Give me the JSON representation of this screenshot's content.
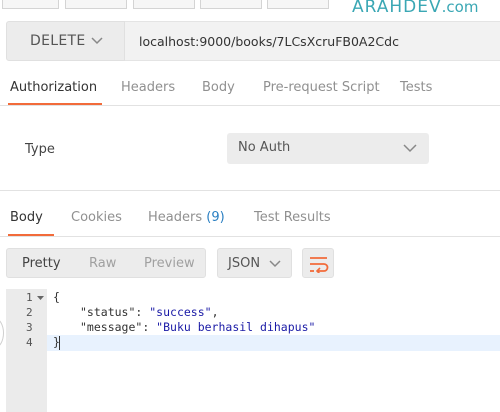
{
  "watermark": {
    "brand": "ARAHDEV",
    "tld": ".com"
  },
  "request": {
    "method": "DELETE",
    "url": "localhost:9000/books/7LCsXcruFB0A2Cdc"
  },
  "request_tabs": [
    {
      "label": "Authorization",
      "active": true
    },
    {
      "label": "Headers",
      "active": false
    },
    {
      "label": "Body",
      "active": false
    },
    {
      "label": "Pre-request Script",
      "active": false
    },
    {
      "label": "Tests",
      "active": false
    }
  ],
  "auth": {
    "type_label": "Type",
    "selected": "No Auth"
  },
  "response_tabs": [
    {
      "label": "Body",
      "active": true
    },
    {
      "label": "Cookies",
      "active": false
    },
    {
      "label": "Headers",
      "count": "(9)",
      "active": false
    },
    {
      "label": "Test Results",
      "active": false
    }
  ],
  "view": {
    "modes": [
      "Pretty",
      "Raw",
      "Preview"
    ],
    "active_mode": "Pretty",
    "format": "JSON"
  },
  "editor": {
    "line_numbers": [
      "1",
      "2",
      "3",
      "4"
    ],
    "lines": [
      {
        "open": "{"
      },
      {
        "key": "\"status\"",
        "sep": ": ",
        "value": "\"success\"",
        "trail": ","
      },
      {
        "key": "\"message\"",
        "sep": ": ",
        "value": "\"Buku berhasil dihapus\"",
        "trail": ""
      },
      {
        "close": "}"
      }
    ]
  },
  "colors": {
    "accent": "#f26b3a",
    "link": "#2a7fc2",
    "watermark": "#3aa7b4"
  }
}
